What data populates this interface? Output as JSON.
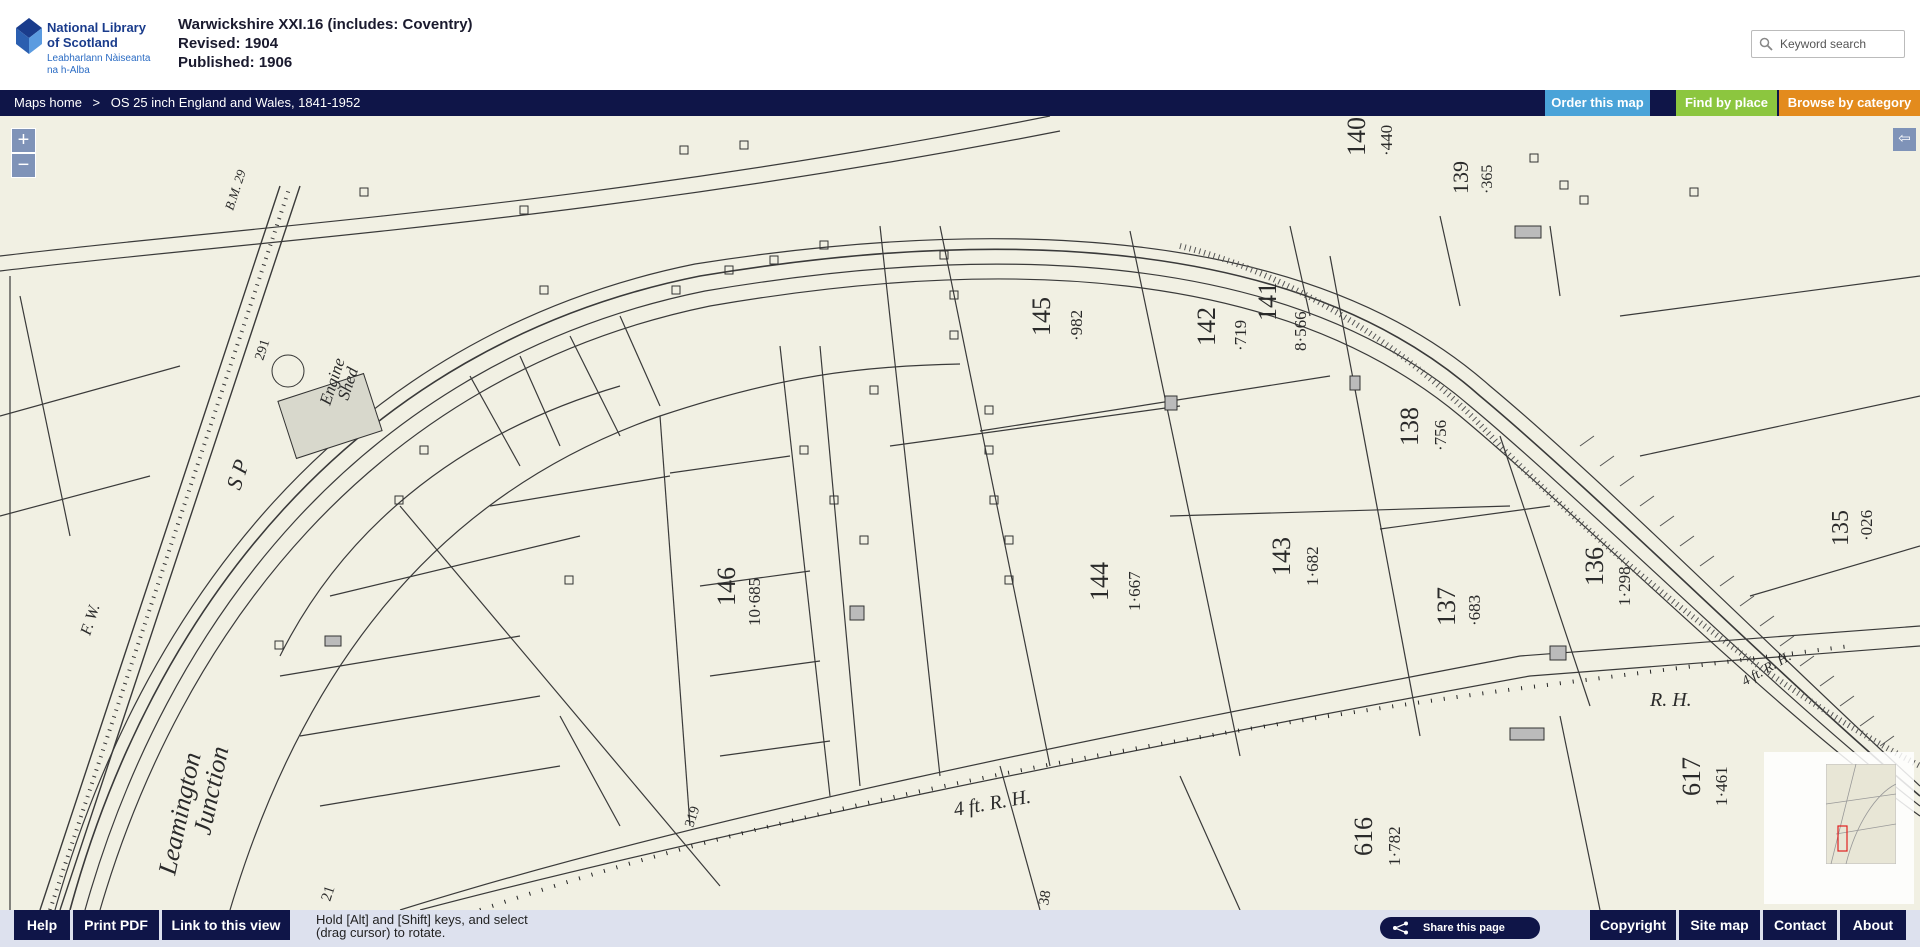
{
  "header": {
    "logo_lines": [
      "National Library",
      "of Scotland",
      "Leabharlann Nàiseanta",
      "na h-Alba"
    ],
    "map_title": "Warwickshire XXI.16 (includes: Coventry)",
    "revised": "Revised: 1904",
    "published": "Published: 1906",
    "search_placeholder": "Keyword search"
  },
  "nav": {
    "breadcrumb_home": "Maps home",
    "breadcrumb_sep": ">",
    "breadcrumb_series": "OS 25 inch England and Wales, 1841-1952",
    "order_label": "Order this map",
    "find_label": "Find by place",
    "browse_label": "Browse by category"
  },
  "map": {
    "zoom_in": "+",
    "zoom_out": "−",
    "collapse": "⇦",
    "labels": {
      "p140": "140",
      "a140": "·440",
      "p139": "139",
      "a139": "·365",
      "p145": "145",
      "a145": "·982",
      "p142": "142",
      "a142": "·719",
      "p141": "141",
      "a141": "8·566",
      "p138": "138",
      "a138": "·756",
      "p146": "146",
      "a146": "10·685",
      "p144": "144",
      "a144": "1·667",
      "p143": "143",
      "a143": "1·682",
      "p137": "137",
      "a137": "·683",
      "p136": "136",
      "a136": "1·298",
      "p135": "135",
      "a135": "·026",
      "p617": "617",
      "a617": "1·461",
      "p616": "616",
      "a616": "1·782",
      "bm": "B.M. 29",
      "n291": "291",
      "engine": "Engine",
      "shed": "Shed",
      "sp": "S P",
      "fw": "F. W.",
      "leamington": "Leamington",
      "junction": "Junction",
      "rh1": "4 ft. R. H.",
      "rh2": "R. H.",
      "rh3": "4 ft. R. H.",
      "n319": "319",
      "n21": "21",
      "n38": "38"
    }
  },
  "footer": {
    "help": "Help",
    "print": "Print PDF",
    "link": "Link to this view",
    "rotate_hint_1": "Hold [Alt] and [Shift] keys, and select",
    "rotate_hint_2": "(drag cursor) to rotate.",
    "share": "Share this page",
    "copyright": "Copyright",
    "sitemap": "Site map",
    "contact": "Contact",
    "about": "About"
  },
  "colors": {
    "navy": "#0f1548",
    "order_btn": "#4aa3d8",
    "find_btn": "#8cc63f",
    "browse_btn": "#e38b1d",
    "map_paper": "#f1f0e3",
    "map_ink": "#2a2a2a",
    "logo_blue": "#1a3c8c"
  }
}
